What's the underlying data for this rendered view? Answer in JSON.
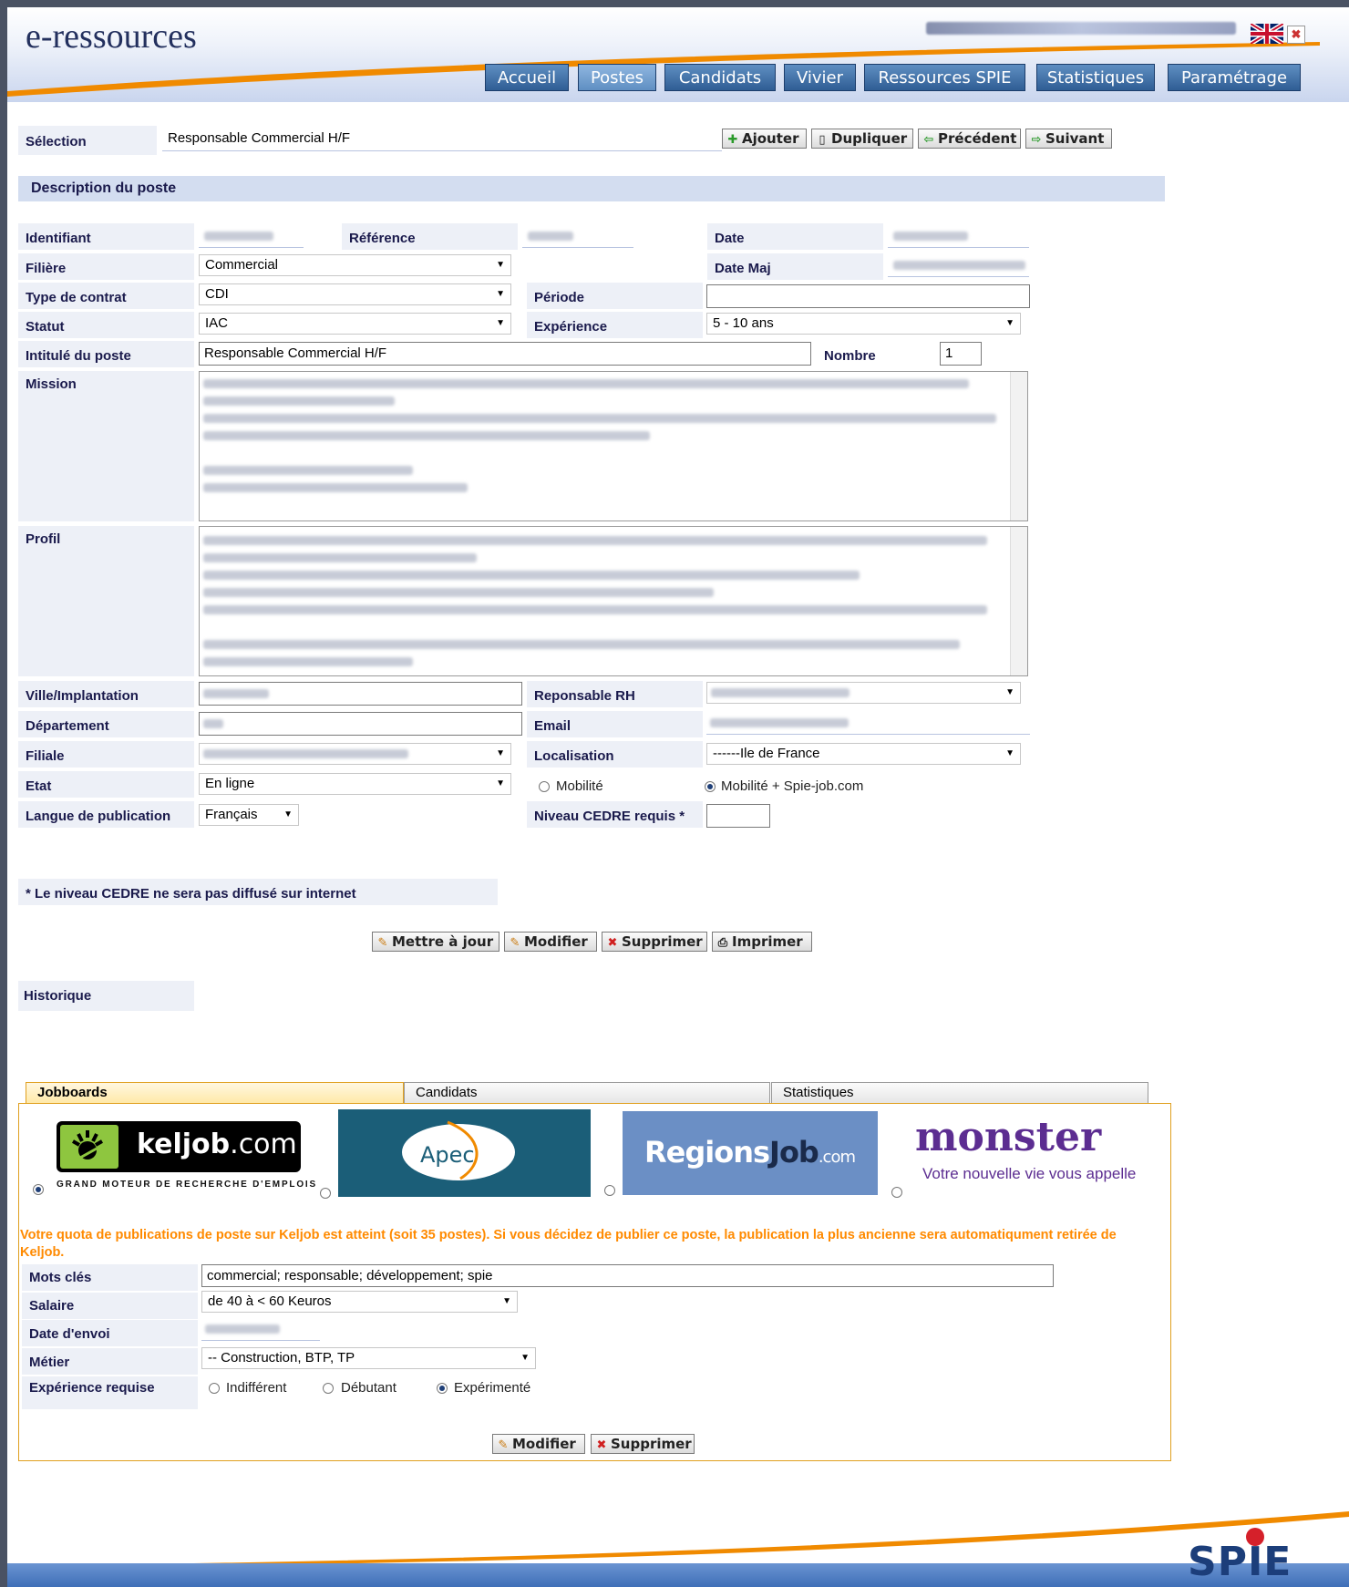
{
  "app": {
    "brand": "e-ressources"
  },
  "nav": [
    "Accueil",
    "Postes",
    "Candidats",
    "Vivier",
    "Ressources SPIE",
    "Statistiques",
    "Paramétrage"
  ],
  "selection": {
    "label": "Sélection",
    "value": "Responsable Commercial H/F",
    "buttons": {
      "add": "Ajouter",
      "duplicate": "Dupliquer",
      "previous": "Précédent",
      "next": "Suivant"
    }
  },
  "section_title": "Description du poste",
  "form": {
    "identifiant_label": "Identifiant",
    "reference_label": "Référence",
    "date_label": "Date",
    "filiere_label": "Filière",
    "filiere_value": "Commercial",
    "date_maj_label": "Date Maj",
    "contrat_label": "Type de contrat",
    "contrat_value": "CDI",
    "periode_label": "Période",
    "periode_value": "",
    "statut_label": "Statut",
    "statut_value": "IAC",
    "experience_label": "Expérience",
    "experience_value": "5 - 10 ans",
    "intitule_label": "Intitulé du poste",
    "intitule_value": "Responsable Commercial H/F",
    "nombre_label": "Nombre",
    "nombre_value": "1",
    "mission_label": "Mission",
    "profil_label": "Profil",
    "ville_label": "Ville/Implantation",
    "rh_label": "Reponsable RH",
    "departement_label": "Département",
    "email_label": "Email",
    "filiale_label": "Filiale",
    "localisation_label": "Localisation",
    "localisation_value": "------Ile de France",
    "etat_label": "Etat",
    "etat_value": "En ligne",
    "mobilite_label": "Mobilité",
    "mobilite_spie_label": "Mobilité + Spie-job.com",
    "langue_label": "Langue de publication",
    "langue_value": "Français",
    "cedre_label": "Niveau CEDRE requis *",
    "cedre_value": ""
  },
  "note": "* Le niveau CEDRE ne sera pas diffusé sur internet",
  "actions": {
    "update": "Mettre à jour",
    "modify": "Modifier",
    "delete": "Supprimer",
    "print": "Imprimer"
  },
  "historique_label": "Historique",
  "tabs": [
    "Jobboards",
    "Candidats",
    "Statistiques"
  ],
  "jobboards": {
    "keljob": {
      "name": "keljob",
      "suffix": ".com",
      "tagline": "GRAND MOTEUR DE RECHERCHE D'EMPLOIS"
    },
    "apec": "Apec",
    "regionsjob": {
      "a": "Regions",
      "b": "Job",
      "c": ".com"
    },
    "monster": {
      "name": "monster",
      "tagline": "Votre nouvelle vie vous appelle"
    },
    "warning": "Votre quota de publications de poste sur Keljob est atteint (soit 35 postes). Si vous décidez de publier ce poste, la publication la plus ancienne sera automatiqument retirée de Keljob.",
    "mots_cles_label": "Mots clés",
    "mots_cles_value": "commercial; responsable; développement; spie",
    "salaire_label": "Salaire",
    "salaire_value": "de 40 à < 60 Keuros",
    "date_envoi_label": "Date d'envoi",
    "metier_label": "Métier",
    "metier_value": "-- Construction, BTP, TP",
    "exp_label": "Expérience requise",
    "exp_options": [
      "Indifférent",
      "Débutant",
      "Expérimenté"
    ],
    "modify": "Modifier",
    "delete": "Supprimer"
  },
  "footer_logo": "SPIE",
  "colors": {
    "accent": "#f08a00",
    "nav": "#2f5d94",
    "label_bg": "#edf0f7",
    "warning": "#ff8a00"
  }
}
